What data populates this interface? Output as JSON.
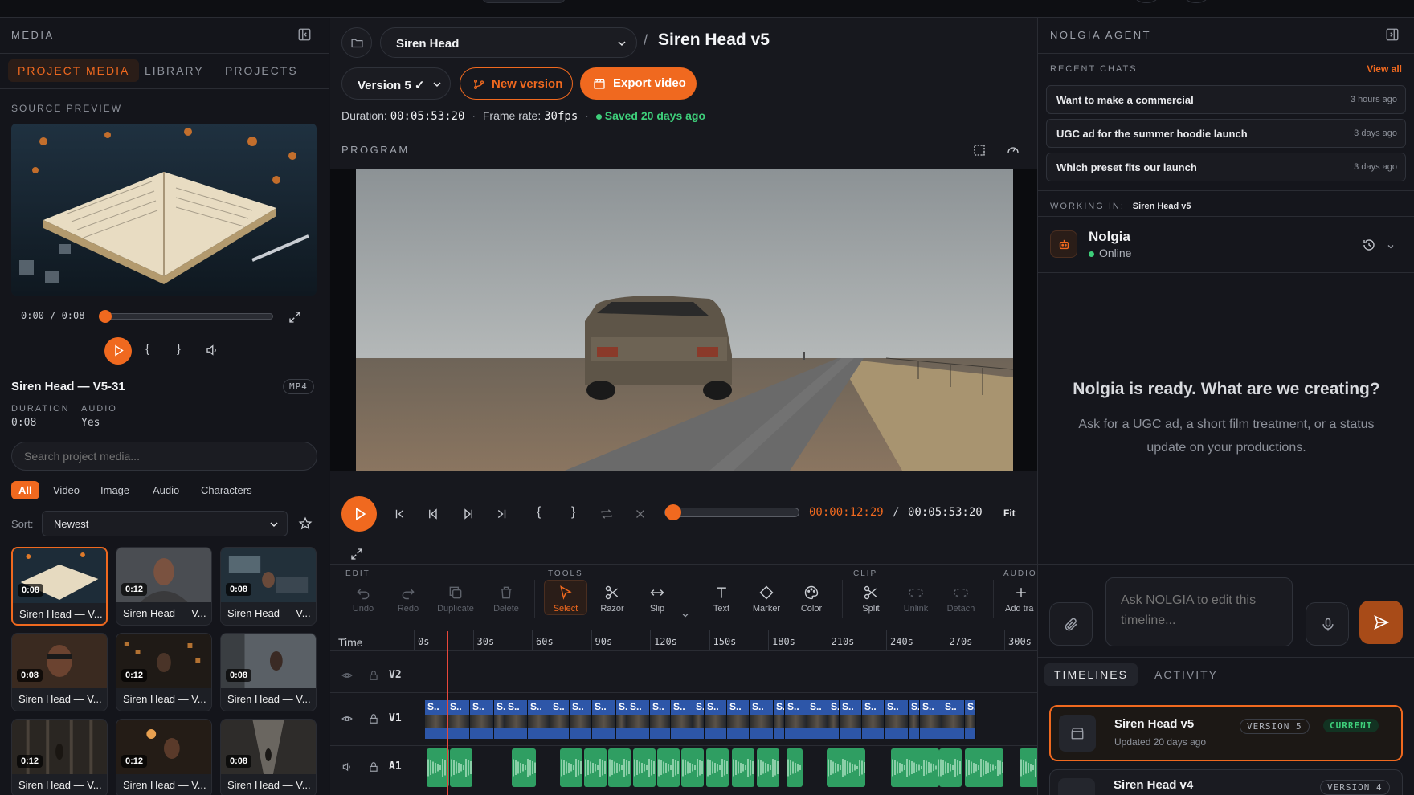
{
  "media_panel": {
    "title": "MEDIA",
    "tabs": [
      "PROJECT MEDIA",
      "LIBRARY",
      "PROJECTS"
    ],
    "source_preview_label": "SOURCE PREVIEW",
    "preview_time": "0:00 / 0:08",
    "clip_name": "Siren Head — V5-31",
    "format_badge": "MP4",
    "duration_label": "DURATION",
    "duration_value": "0:08",
    "audio_label": "AUDIO",
    "audio_value": "Yes",
    "search_placeholder": "Search project media...",
    "filters": [
      "All",
      "Video",
      "Image",
      "Audio",
      "Characters"
    ],
    "sort_label": "Sort:",
    "sort_value": "Newest",
    "thumbnails": [
      {
        "dur": "0:08",
        "name": "Siren Head — V..."
      },
      {
        "dur": "0:12",
        "name": "Siren Head — V..."
      },
      {
        "dur": "0:08",
        "name": "Siren Head — V..."
      },
      {
        "dur": "0:08",
        "name": "Siren Head — V..."
      },
      {
        "dur": "0:12",
        "name": "Siren Head — V..."
      },
      {
        "dur": "0:08",
        "name": "Siren Head — V..."
      },
      {
        "dur": "0:12",
        "name": "Siren Head — V..."
      },
      {
        "dur": "0:12",
        "name": "Siren Head — V..."
      },
      {
        "dur": "0:08",
        "name": "Siren Head — V..."
      }
    ]
  },
  "editor": {
    "project_select": "Siren Head",
    "separator": "/",
    "timeline_title": "Siren Head v5",
    "version_select": "Version 5 ✓",
    "new_version": "New version",
    "export": "Export video",
    "duration_label": "Duration:",
    "duration_value": "00:05:53:20",
    "framerate_label": "Frame rate:",
    "framerate_value": "30fps",
    "saved": "Saved 20 days ago",
    "program_label": "PROGRAM",
    "current_time": "00:00:12:29",
    "time_sep": "/",
    "total_time": "00:05:53:20",
    "fit": "Fit",
    "playhead_fraction": 0.036,
    "tool_groups": {
      "edit": "EDIT",
      "tools": "TOOLS",
      "clip": "CLIP",
      "audio": "AUDIO"
    },
    "tools": {
      "undo": "Undo",
      "redo": "Redo",
      "duplicate": "Duplicate",
      "delete": "Delete",
      "select": "Select",
      "razor": "Razor",
      "slip": "Slip",
      "text": "Text",
      "marker": "Marker",
      "color": "Color",
      "split": "Split",
      "unlink": "Unlink",
      "detach": "Detach",
      "add_track": "Add tra"
    },
    "timeline": {
      "time_label": "Time",
      "ruler": [
        "0s",
        "30s",
        "60s",
        "90s",
        "120s",
        "150s",
        "180s",
        "210s",
        "240s",
        "270s",
        "300s"
      ],
      "tracks": [
        "V2",
        "V1",
        "A1"
      ],
      "clip_label": "S.."
    }
  },
  "agent": {
    "title": "NOLGIA AGENT",
    "recent_label": "RECENT CHATS",
    "view_all": "View all",
    "chats": [
      {
        "title": "Want to make a commercial",
        "time": "3 hours ago"
      },
      {
        "title": "UGC ad for the summer hoodie launch",
        "time": "3 days ago"
      },
      {
        "title": "Which preset fits our launch",
        "time": "3 days ago"
      }
    ],
    "working_label": "WORKING IN:",
    "working_value": "Siren Head v5",
    "agent_name": "Nolgia",
    "status": "Online",
    "ready_title": "Nolgia is ready. What are we creating?",
    "ready_sub": "Ask for a UGC ad, a short film treatment, or a status update on your productions.",
    "input_placeholder": "Ask NOLGIA to edit this timeline...",
    "tabs": [
      "TIMELINES",
      "ACTIVITY"
    ],
    "versions": [
      {
        "name": "Siren Head v5",
        "updated": "Updated 20 days ago",
        "badge": "VERSION 5",
        "current": "CURRENT"
      },
      {
        "name": "Siren Head v4",
        "badge": "VERSION 4"
      }
    ]
  },
  "colors": {
    "accent": "#f0691f",
    "success": "#3ecf7a",
    "audio_clip": "#2f9e62",
    "video_clip": "#3b6fd1"
  }
}
